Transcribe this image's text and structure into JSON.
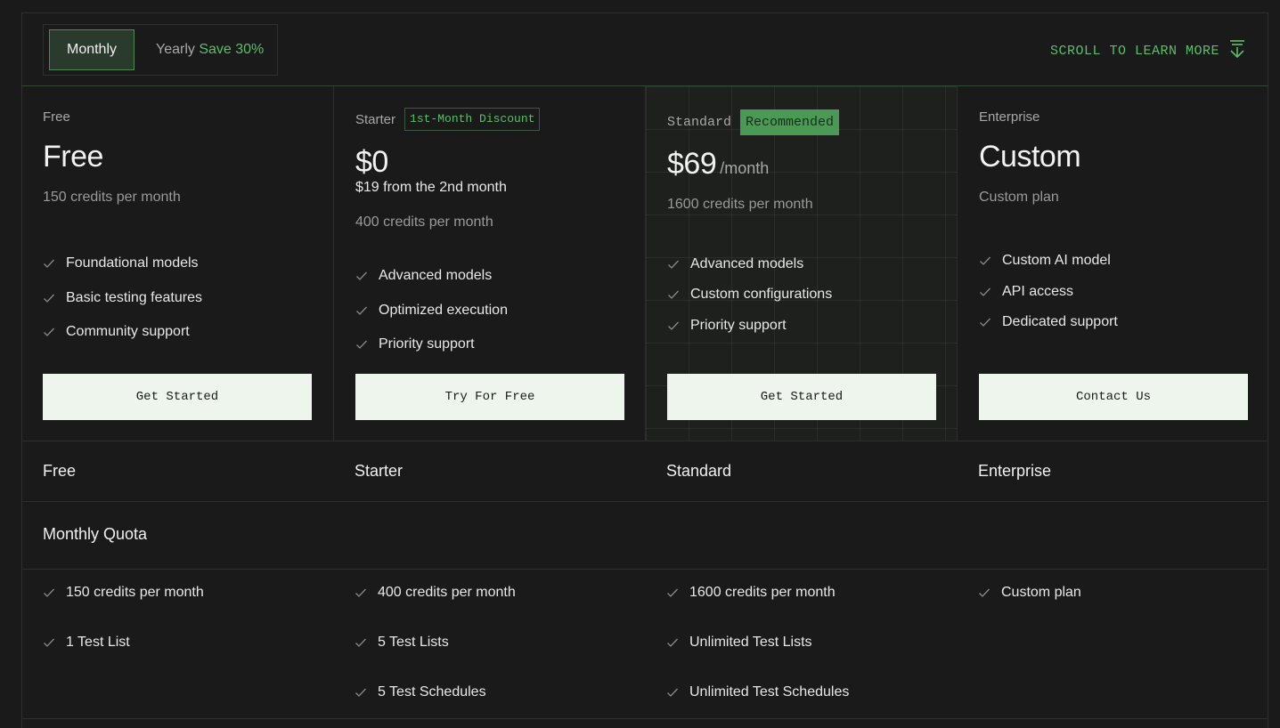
{
  "billing": {
    "monthly_label": "Monthly",
    "yearly_label": "Yearly",
    "yearly_save": "Save 30%",
    "selected": "Monthly"
  },
  "scroll_hint": {
    "label": "SCROLL TO LEARN MORE",
    "icon": "arrow-down-icon"
  },
  "colors": {
    "accent": "#5bbf6a",
    "background": "#1a1a1a",
    "button_bg": "#eef5ec",
    "badge_bg": "#4a9a56"
  },
  "plans": [
    {
      "name": "Free",
      "price": "Free",
      "credits": "150 credits per month",
      "features": [
        "Foundational models",
        "Basic testing features",
        "Community support"
      ],
      "cta": "Get Started"
    },
    {
      "name": "Starter",
      "badge": "1st-Month Discount",
      "price": "$0",
      "sub_price": "$19 from the 2nd month",
      "credits": "400 credits per month",
      "features": [
        "Advanced models",
        "Optimized execution",
        "Priority support"
      ],
      "cta": "Try For Free"
    },
    {
      "name": "Standard",
      "badge": "Recommended",
      "price": "$69",
      "period": "/month",
      "credits": "1600 credits per month",
      "features": [
        "Advanced models",
        "Custom configurations",
        "Priority support"
      ],
      "cta": "Get Started"
    },
    {
      "name": "Enterprise",
      "price": "Custom",
      "credits": "Custom plan",
      "features": [
        "Custom AI model",
        "API access",
        "Dedicated support"
      ],
      "cta": "Contact Us"
    }
  ],
  "comparison": {
    "columns": [
      "Free",
      "Starter",
      "Standard",
      "Enterprise"
    ],
    "section_title": "Monthly Quota",
    "rows": [
      [
        "150 credits per month",
        "400 credits per month",
        "1600 credits per month",
        "Custom plan"
      ],
      [
        "1 Test List",
        "5 Test Lists",
        "Unlimited Test Lists",
        ""
      ],
      [
        "",
        "5 Test Schedules",
        "Unlimited Test Schedules",
        ""
      ]
    ]
  }
}
